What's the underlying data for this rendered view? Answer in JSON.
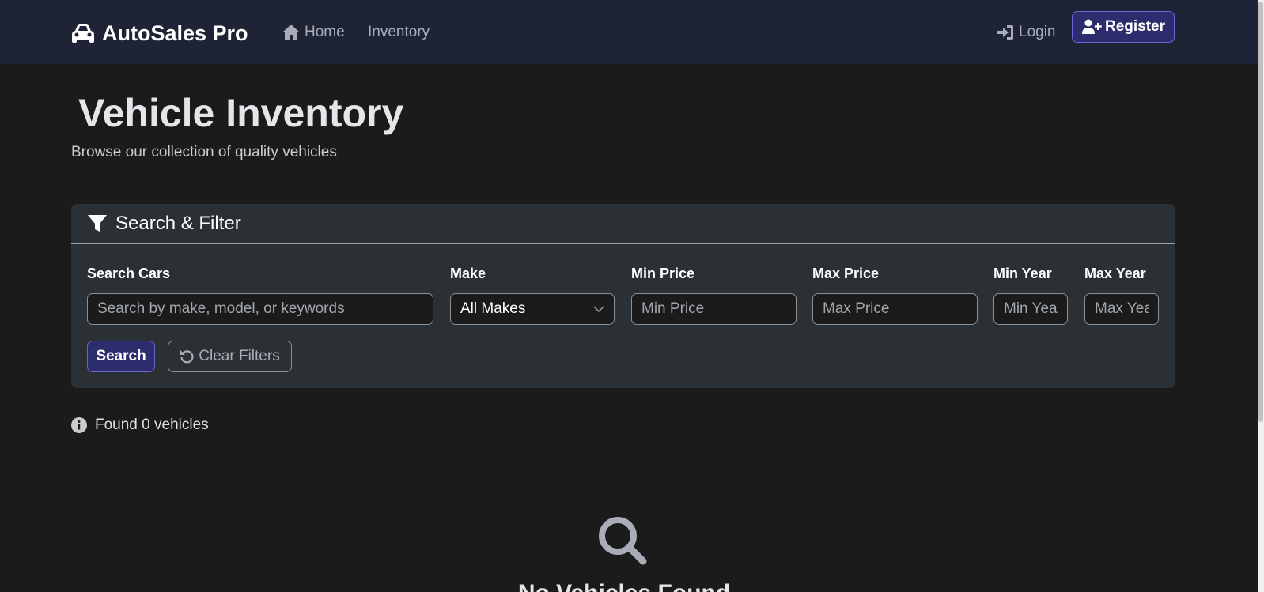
{
  "nav": {
    "brand": "AutoSales Pro",
    "home": "Home",
    "inventory": "Inventory",
    "login": "Login",
    "register": "Register"
  },
  "page": {
    "title": "Vehicle Inventory",
    "subtitle": "Browse our collection of quality vehicles"
  },
  "filter": {
    "header": "Search & Filter",
    "search_label": "Search Cars",
    "search_placeholder": "Search by make, model, or keywords",
    "make_label": "Make",
    "make_selected": "All Makes",
    "min_price_label": "Min Price",
    "min_price_placeholder": "Min Price",
    "max_price_label": "Max Price",
    "max_price_placeholder": "Max Price",
    "min_year_label": "Min Year",
    "min_year_placeholder": "Min Year",
    "max_year_label": "Max Year",
    "max_year_placeholder": "Max Year",
    "search_button": "Search",
    "clear_button": "Clear Filters"
  },
  "results": {
    "count_text": "Found 0 vehicles",
    "empty_title": "No Vehicles Found"
  },
  "colors": {
    "navbar_bg": "#1e2435",
    "page_bg": "#1b1b1b",
    "card_bg": "#2b3035",
    "primary_button_bg": "#2c2d6d",
    "primary_button_border": "#6f63d6"
  },
  "icons": {
    "brand": "car-icon",
    "home": "house-icon",
    "login": "sign-in-icon",
    "register": "user-plus-icon",
    "filter": "filter-icon",
    "clear": "undo-icon",
    "info": "info-circle-icon",
    "empty": "search-icon"
  }
}
